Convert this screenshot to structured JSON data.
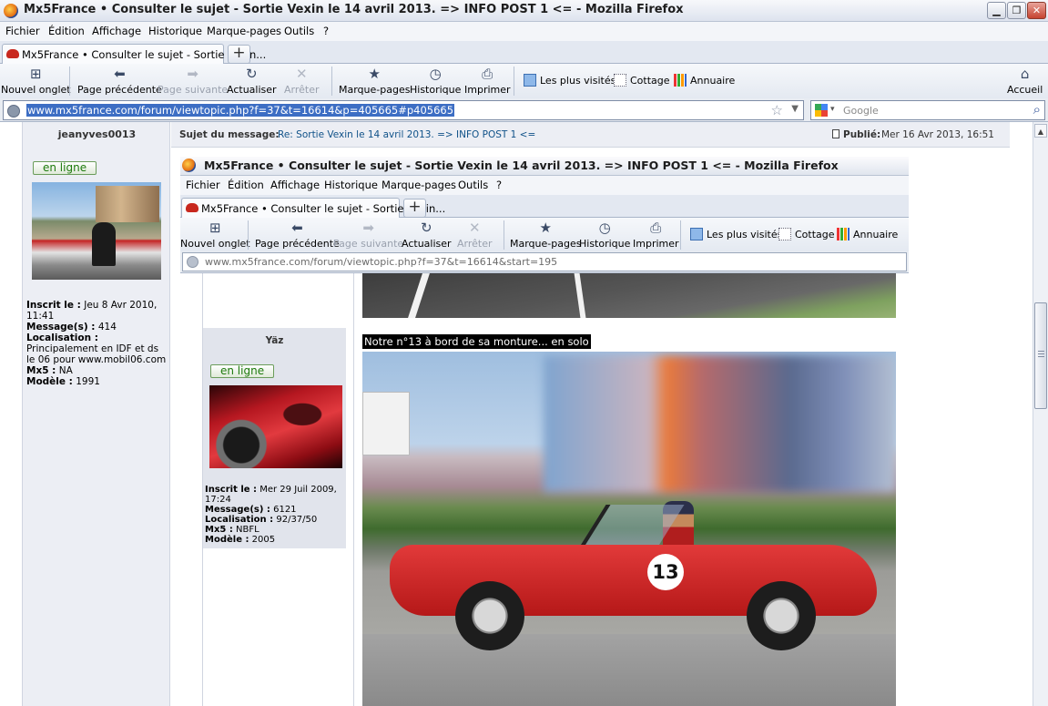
{
  "window": {
    "title": "Mx5France • Consulter le sujet - Sortie Vexin le 14 avril 2013. => INFO POST 1 <= - Mozilla Firefox",
    "controls": {
      "minimize": "▁",
      "restore": "❐",
      "close": "✕"
    }
  },
  "menu": [
    "Fichier",
    "Édition",
    "Affichage",
    "Historique",
    "Marque-pages",
    "Outils",
    "?"
  ],
  "tab": {
    "label": "Mx5France • Consulter le sujet - Sortie Vexin...",
    "new_tab_symbol": "+"
  },
  "toolbar": {
    "new_tab": "Nouvel onglet",
    "back": "Page précédente",
    "forward": "Page suivante",
    "reload": "Actualiser",
    "stop": "Arrêter",
    "bookmarks": "Marque-pages",
    "history": "Historique",
    "print": "Imprimer",
    "home": "Accueil"
  },
  "bookmarks_bar": [
    "Les plus visités",
    "Cottage",
    "Annuaire"
  ],
  "address": {
    "url": "www.mx5france.com/forum/viewtopic.php?f=37&t=16614&p=405665#p405665"
  },
  "search": {
    "placeholder": "Google"
  },
  "post": {
    "subject_label": "Sujet du message:",
    "subject": "Re: Sortie Vexin le 14 avril 2013. => INFO POST 1 <=",
    "published_label": "Publié:",
    "published_date": "Mer 16 Avr 2013, 16:51",
    "author": {
      "name": "jeanyves0013",
      "status": "en ligne",
      "registered_label": "Inscrit le :",
      "registered": "Jeu 8 Avr 2010, 11:41",
      "messages_label": "Message(s) :",
      "messages": "414",
      "location_label": "Localisation :",
      "location": "Principalement en IDF et ds le 06 pour www.mobil06.com",
      "mx5_label": "Mx5 :",
      "mx5": "NA",
      "model_label": "Modèle :",
      "model": "1991"
    }
  },
  "embedded": {
    "title": "Mx5France • Consulter le sujet - Sortie Vexin le 14 avril 2013. => INFO POST 1 <= - Mozilla Firefox",
    "menu": [
      "Fichier",
      "Édition",
      "Affichage",
      "Historique",
      "Marque-pages",
      "Outils",
      "?"
    ],
    "tab": "Mx5France • Consulter le sujet - Sortie Vexin...",
    "toolbar": {
      "new_tab": "Nouvel onglet",
      "back": "Page précédente",
      "forward": "Page suivante",
      "reload": "Actualiser",
      "stop": "Arrêter",
      "bookmarks": "Marque-pages",
      "history": "Historique",
      "print": "Imprimer"
    },
    "bookmarks_bar": [
      "Les plus visités",
      "Cottage",
      "Annuaire"
    ],
    "url": "www.mx5france.com/forum/viewtopic.php?f=37&t=16614&start=195",
    "author": {
      "name": "Yäz",
      "status": "en ligne",
      "registered_label": "Inscrit le :",
      "registered": "Mer 29 Juil 2009, 17:24",
      "messages_label": "Message(s) :",
      "messages": "6121",
      "location_label": "Localisation :",
      "location": "92/37/50",
      "mx5_label": "Mx5 :",
      "mx5": "NBFL",
      "model_label": "Modèle :",
      "model": "2005"
    },
    "caption": "Notre n°13 à bord de sa monture... en solo",
    "car_number": "13"
  }
}
